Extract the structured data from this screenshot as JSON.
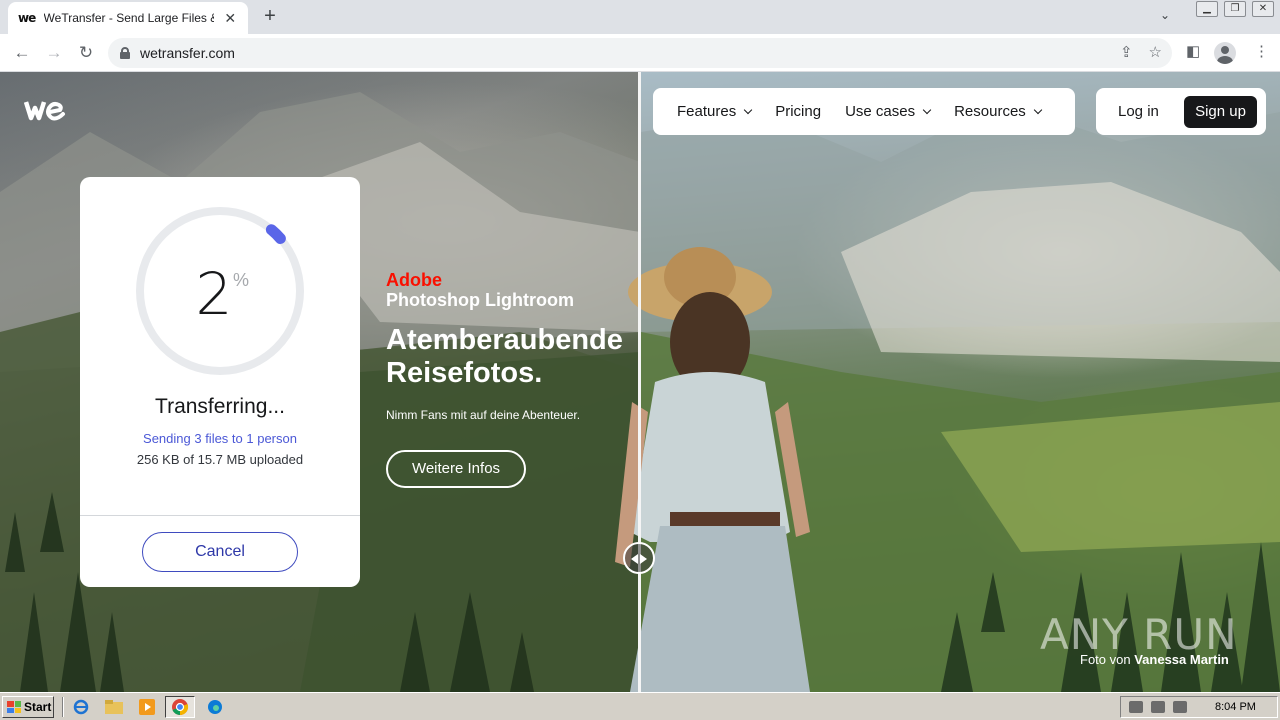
{
  "browser": {
    "tab_title": "WeTransfer - Send Large Files & Sha",
    "tab_favicon": "we",
    "url": "wetransfer.com",
    "window_controls": [
      "minimize",
      "restore",
      "close"
    ]
  },
  "logo": {
    "text": "we",
    "icon": "wetransfer-logo"
  },
  "nav": {
    "items": [
      {
        "label": "Features",
        "has_dropdown": true
      },
      {
        "label": "Pricing",
        "has_dropdown": false
      },
      {
        "label": "Use cases",
        "has_dropdown": true
      },
      {
        "label": "Resources",
        "has_dropdown": true
      }
    ],
    "login_label": "Log in",
    "signup_label": "Sign up"
  },
  "transfer": {
    "percent": "2",
    "percent_sign": "%",
    "progress_fraction": 0.02,
    "title": "Transferring...",
    "subtitle": "Sending 3 files to 1 person",
    "size_text": "256 KB of 15.7 MB uploaded",
    "cancel_label": "Cancel",
    "accent_color": "#4b58d6"
  },
  "ad": {
    "brand": "Adobe",
    "product": "Photoshop Lightroom",
    "headline": "Atemberaubende Reisefotos.",
    "body": "Nimm Fans mit auf deine Abenteuer.",
    "cta": "Weitere Infos"
  },
  "photo_credit": {
    "prefix": "Foto von",
    "name": "Vanessa Martin"
  },
  "watermark": "ANY RUN",
  "taskbar": {
    "start_label": "Start",
    "apps": [
      "ie-icon",
      "folder-icon",
      "media-player-icon",
      "chrome-icon",
      "edge-icon"
    ],
    "clock": "8:04 PM"
  },
  "colors": {
    "brand_dark": "#17181a",
    "adobe_red": "#fa0f00",
    "progress_track": "#e8eaed",
    "progress_fill": "#5a66e8"
  }
}
